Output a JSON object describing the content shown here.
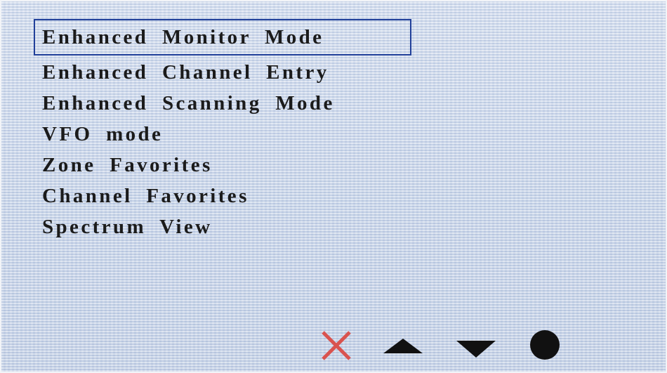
{
  "menu": {
    "items": [
      {
        "label": "Enhanced Monitor Mode",
        "selected": true
      },
      {
        "label": "Enhanced Channel Entry",
        "selected": false
      },
      {
        "label": "Enhanced Scanning Mode",
        "selected": false
      },
      {
        "label": "VFO mode",
        "selected": false
      },
      {
        "label": "Zone Favorites",
        "selected": false
      },
      {
        "label": "Channel Favorites",
        "selected": false
      },
      {
        "label": "Spectrum View",
        "selected": false
      }
    ]
  },
  "softkeys": {
    "close": {
      "icon": "close-icon",
      "color": "#d9534f"
    },
    "up": {
      "icon": "triangle-up-icon",
      "color": "#111111"
    },
    "down": {
      "icon": "triangle-down-icon",
      "color": "#111111"
    },
    "select": {
      "icon": "filled-circle-icon",
      "color": "#111111"
    }
  },
  "colors": {
    "background": "#c9d6ea",
    "selection_border": "#21409a",
    "text": "#1b1b1b"
  }
}
